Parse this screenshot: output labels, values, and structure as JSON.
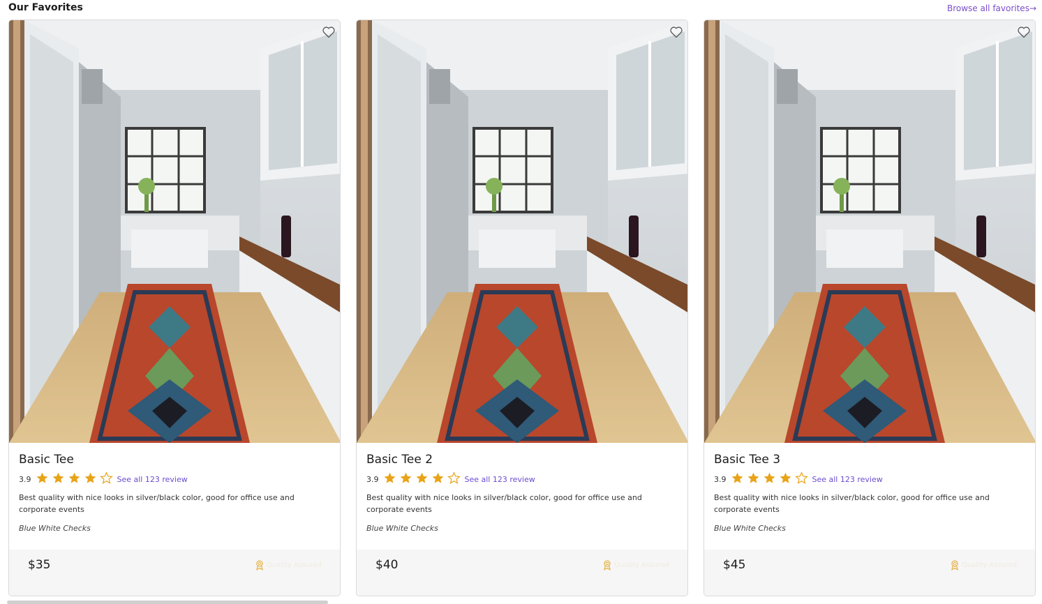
{
  "section": {
    "title": "Our Favorites",
    "browse_link": "Browse all favorites→"
  },
  "cards": [
    {
      "title": "Basic Tee",
      "rating": "3.9",
      "stars_filled": 4,
      "stars_total": 5,
      "reviews_link": "See all 123 review",
      "description": "Best quality with nice looks in silver/black color, good for office use and corporate events",
      "variant": "Blue White Checks",
      "price": "$35",
      "quality": "Quality Assured"
    },
    {
      "title": "Basic Tee 2",
      "rating": "3.9",
      "stars_filled": 4,
      "stars_total": 5,
      "reviews_link": "See all 123 review",
      "description": "Best quality with nice looks in silver/black color, good for office use and corporate events",
      "variant": "Blue White Checks",
      "price": "$40",
      "quality": "Quality Assured"
    },
    {
      "title": "Basic Tee 3",
      "rating": "3.9",
      "stars_filled": 4,
      "stars_total": 5,
      "reviews_link": "See all 123 review",
      "description": "Best quality with nice looks in silver/black color, good for office use and corporate events",
      "variant": "Blue White Checks",
      "price": "$45",
      "quality": "Quality Assured"
    }
  ],
  "colors": {
    "accent": "#7c4dcc",
    "star": "#e8a317",
    "footer_bg": "#f6f6f6"
  },
  "icons": {
    "favorite": "heart-outline-icon",
    "rating": "star-icon",
    "quality": "award-badge-icon"
  }
}
